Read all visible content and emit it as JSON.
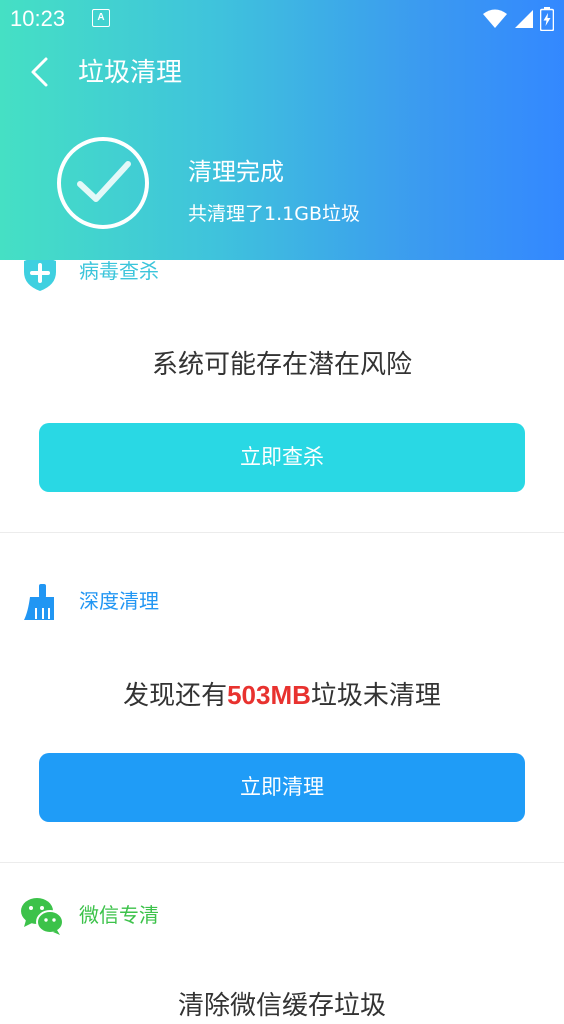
{
  "status_bar": {
    "time": "10:23",
    "notification_icon": "A",
    "icons": [
      "wifi-icon",
      "signal-icon",
      "battery-charging-icon"
    ]
  },
  "header": {
    "title": "垃圾清理",
    "result_title": "清理完成",
    "result_subtitle": "共清理了1.1GB垃圾"
  },
  "sections": [
    {
      "title": "病毒查杀",
      "icon": "shield-plus-icon",
      "message": "系统可能存在潜在风险",
      "button": "立即查杀",
      "color": "#3cc5db",
      "button_color": "#29d8e4"
    },
    {
      "title": "深度清理",
      "icon": "broom-icon",
      "message_prefix": "发现还有",
      "message_highlight": "503MB",
      "message_suffix": "垃圾未清理",
      "button": "立即清理",
      "color": "#2196f3",
      "button_color": "#1f9cf7"
    },
    {
      "title": "微信专清",
      "icon": "wechat-icon",
      "message": "清除微信缓存垃圾",
      "color": "#3cc24a"
    }
  ],
  "colors": {
    "header_gradient_start": "#45e0c4",
    "header_gradient_end": "#3388ff",
    "highlight": "#e8322f"
  }
}
